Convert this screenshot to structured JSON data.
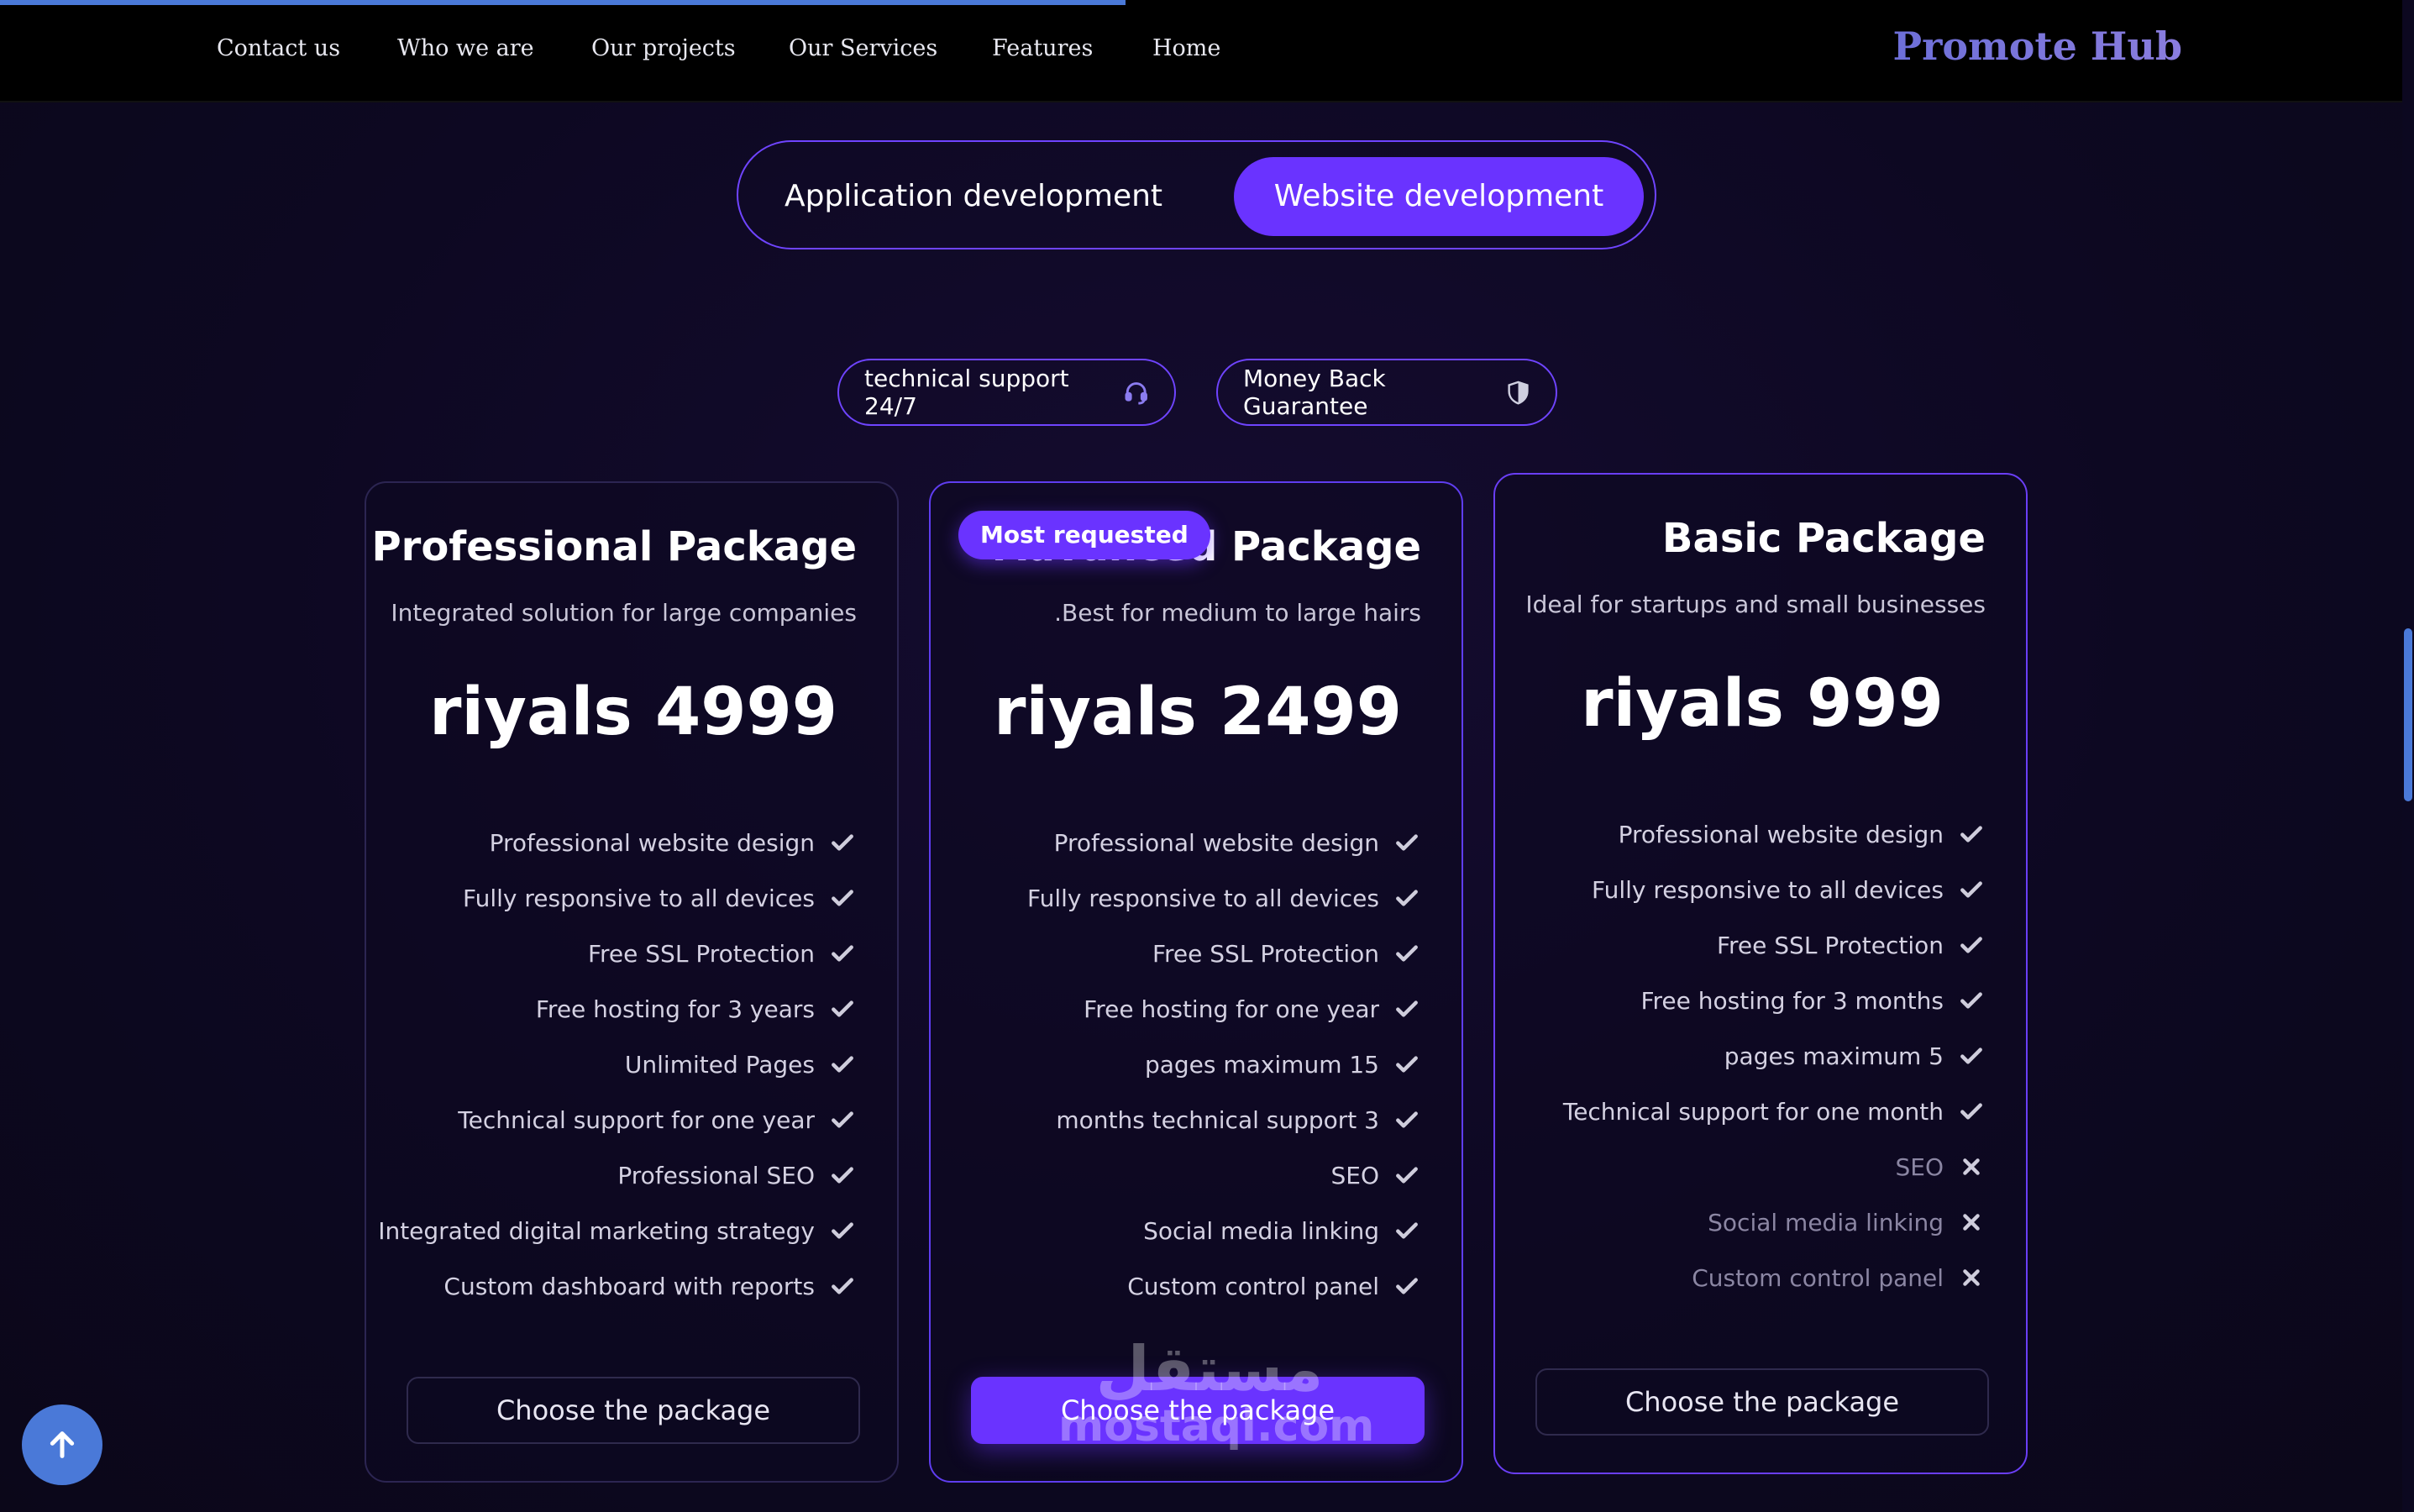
{
  "nav": {
    "links": [
      "Contact us",
      "Who we are",
      "Our projects",
      "Our Services",
      "Features",
      "Home"
    ],
    "brand": "Promote Hub"
  },
  "toggle": {
    "options": [
      "Application development",
      "Website development"
    ],
    "selected": "Website development"
  },
  "pills": [
    {
      "label": "technical support 24/7",
      "icon": "headset-icon"
    },
    {
      "label": "Money Back Guarantee",
      "icon": "shield-icon"
    }
  ],
  "packages": [
    {
      "title": "Professional Package",
      "subtitle": "Integrated solution for large companies",
      "price": "riyals 4999",
      "features": [
        {
          "text": "Professional website design",
          "included": true
        },
        {
          "text": "Fully responsive to all devices",
          "included": true
        },
        {
          "text": "Free SSL Protection",
          "included": true
        },
        {
          "text": "Free hosting for 3 years",
          "included": true
        },
        {
          "text": "Unlimited Pages",
          "included": true
        },
        {
          "text": "Technical support for one year",
          "included": true
        },
        {
          "text": "Professional SEO",
          "included": true
        },
        {
          "text": "Integrated digital marketing strategy",
          "included": true
        },
        {
          "text": "Custom dashboard with reports",
          "included": true
        }
      ],
      "cta": "Choose the package"
    },
    {
      "title": "Advanced Package",
      "badge": "Most requested",
      "subtitle": ".Best for medium to large hairs",
      "price": "riyals 2499",
      "features": [
        {
          "text": "Professional website design",
          "included": true
        },
        {
          "text": "Fully responsive to all devices",
          "included": true
        },
        {
          "text": "Free SSL Protection",
          "included": true
        },
        {
          "text": "Free hosting for one year",
          "included": true
        },
        {
          "text": "pages maximum 15",
          "included": true
        },
        {
          "text": "months technical support 3",
          "included": true
        },
        {
          "text": "SEO",
          "included": true
        },
        {
          "text": "Social media linking",
          "included": true
        },
        {
          "text": "Custom control panel",
          "included": true
        }
      ],
      "cta": "Choose the package"
    },
    {
      "title": "Basic Package",
      "subtitle": "Ideal for startups and small businesses",
      "price": "riyals 999",
      "features": [
        {
          "text": "Professional website design",
          "included": true
        },
        {
          "text": "Fully responsive to all devices",
          "included": true
        },
        {
          "text": "Free SSL Protection",
          "included": true
        },
        {
          "text": "Free hosting for 3 months",
          "included": true
        },
        {
          "text": "pages maximum 5",
          "included": true
        },
        {
          "text": "Technical support for one month",
          "included": true
        },
        {
          "text": "SEO",
          "included": false
        },
        {
          "text": "Social media linking",
          "included": false
        },
        {
          "text": "Custom control panel",
          "included": false
        }
      ],
      "cta": "Choose the package"
    }
  ],
  "watermark": {
    "arabic": "مستقل",
    "latin": "mostaql.com"
  },
  "colors": {
    "accent": "#6a33ff",
    "scroll": "#4a79d8",
    "brand": "#7a78dc"
  }
}
